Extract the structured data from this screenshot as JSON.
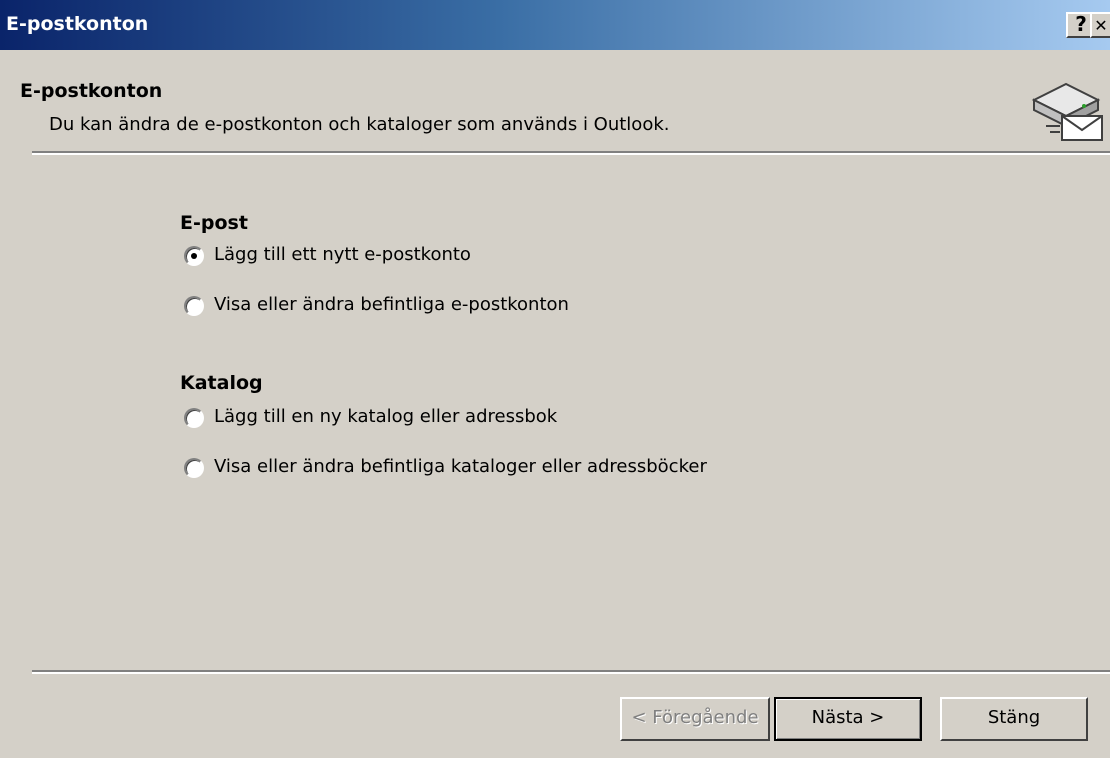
{
  "window": {
    "title": "E-postkonton",
    "help_label": "?",
    "close_label": "✕"
  },
  "header": {
    "title": "E-postkonton",
    "subtitle": "Du kan ändra de e-postkonton och kataloger som används i Outlook.",
    "icon": "email-server-icon"
  },
  "email_group": {
    "label": "E-post",
    "options": [
      {
        "label": "Lägg till ett nytt e-postkonto",
        "selected": true
      },
      {
        "label": "Visa eller ändra befintliga e-postkonton",
        "selected": false
      }
    ]
  },
  "directory_group": {
    "label": "Katalog",
    "options": [
      {
        "label": "Lägg till en ny katalog eller adressbok",
        "selected": false
      },
      {
        "label": "Visa eller ändra befintliga kataloger eller adressböcker",
        "selected": false
      }
    ]
  },
  "buttons": {
    "previous": "< Föregående",
    "next": "Nästa >",
    "close": "Stäng"
  },
  "colors": {
    "face": "#d4d0c8",
    "titlebar_start": "#0a246a",
    "titlebar_end": "#a6caf0"
  }
}
